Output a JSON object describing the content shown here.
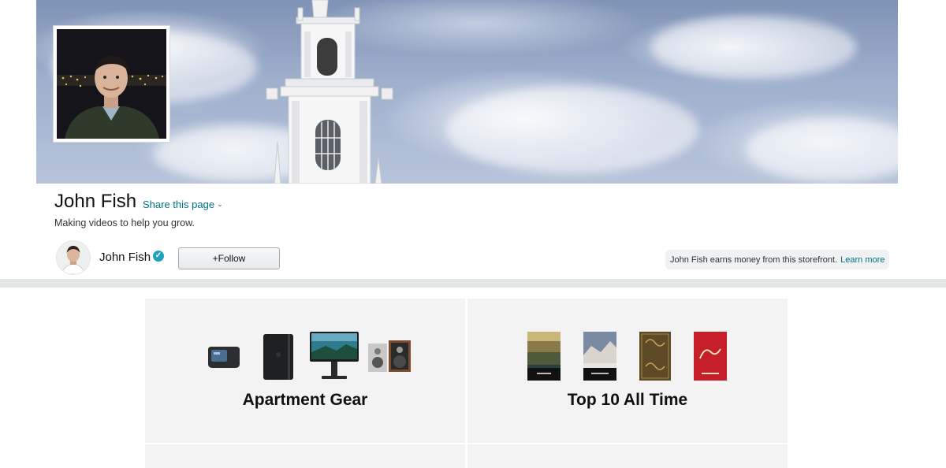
{
  "profile": {
    "name": "John Fish",
    "share_label": "Share this page",
    "tagline": "Making videos to help you grow.",
    "creator_name": "John Fish",
    "follow_label": "+Follow",
    "earns_text": "John Fish earns money from this storefront.",
    "learn_more_label": "Learn more"
  },
  "colors": {
    "link": "#007185",
    "verified": "#1fa0bd",
    "divider": "#e3e6e6",
    "card_bg": "#f3f3f3"
  },
  "collections": [
    {
      "title": "Apartment Gear"
    },
    {
      "title": "Top 10 All Time"
    }
  ]
}
